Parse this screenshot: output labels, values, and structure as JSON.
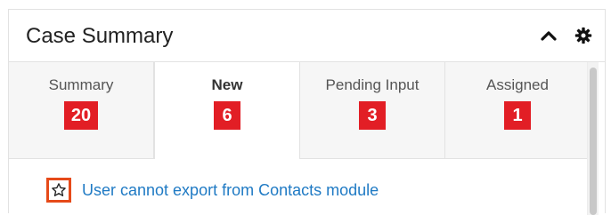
{
  "dashlet": {
    "title": "Case Summary",
    "icons": {
      "collapse": "chevron-up-icon",
      "settings": "gear-icon"
    }
  },
  "tabs": [
    {
      "label": "Summary",
      "count": "20",
      "active": false
    },
    {
      "label": "New",
      "count": "6",
      "active": true
    },
    {
      "label": "Pending Input",
      "count": "3",
      "active": false
    },
    {
      "label": "Assigned",
      "count": "1",
      "active": false
    }
  ],
  "colors": {
    "badge": "#e21e25",
    "link": "#1f7ac4",
    "highlight": "#e64a19"
  },
  "list": {
    "items": [
      {
        "title": "User cannot export from Contacts module",
        "favorite_icon": "star-outline-icon"
      }
    ]
  }
}
